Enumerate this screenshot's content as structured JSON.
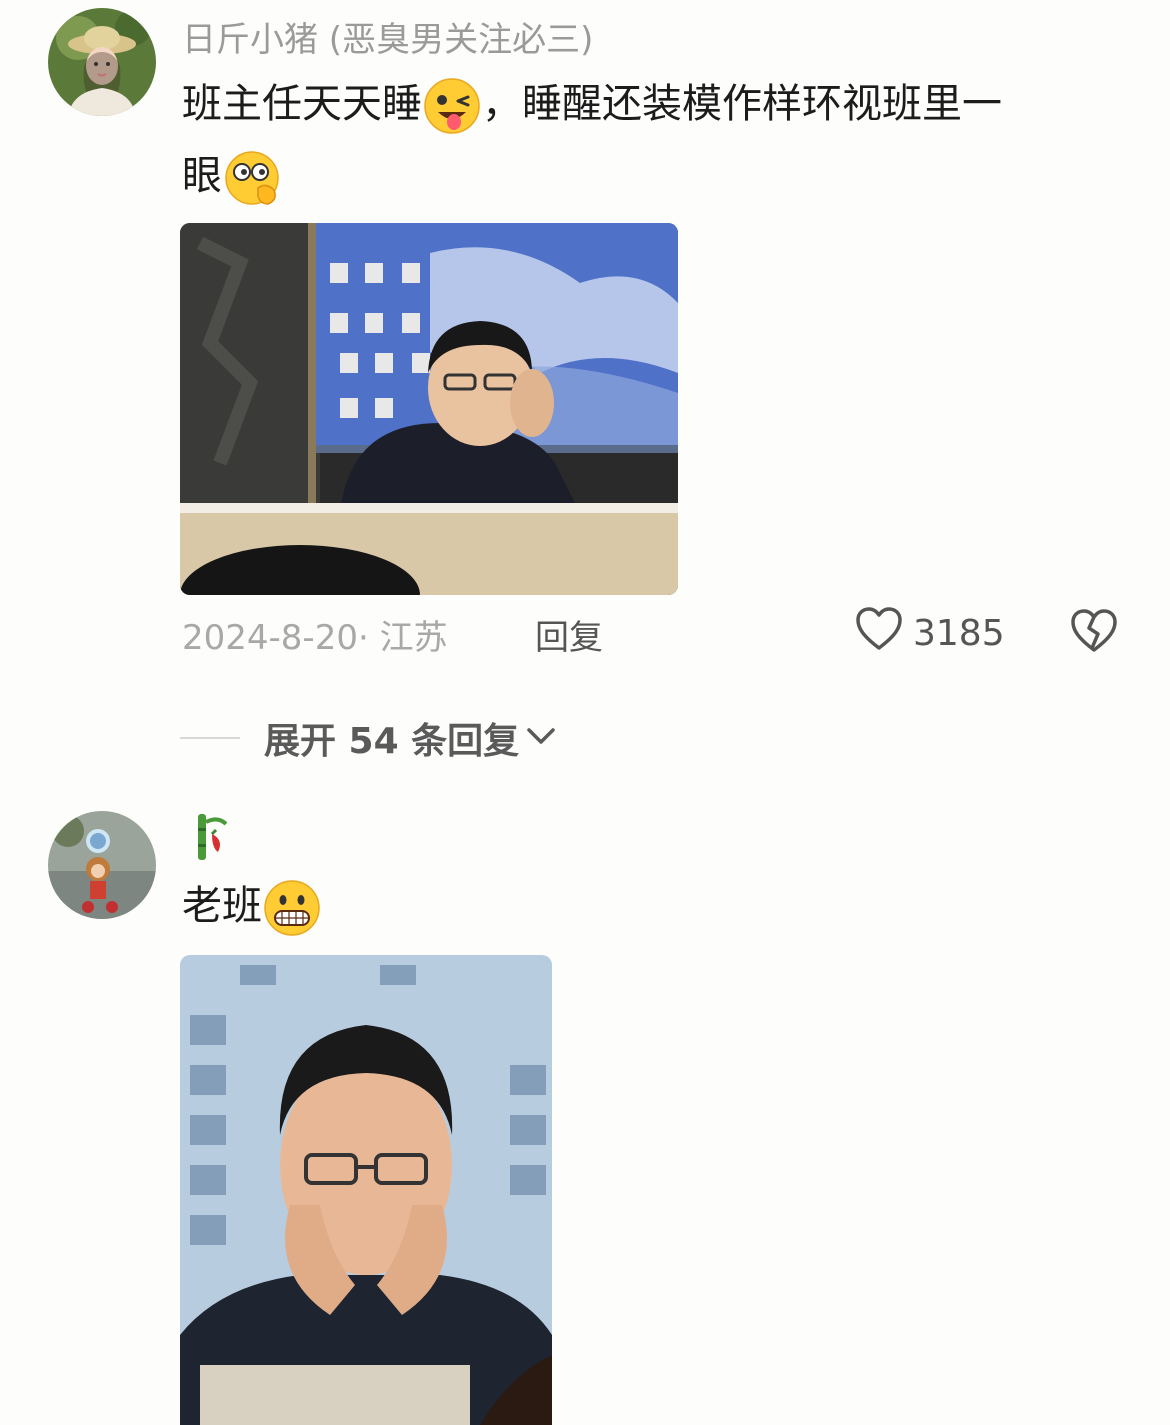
{
  "comments": [
    {
      "username": "日斤小猪 (恶臭男关注必三)",
      "text_part1": "班主任天天睡",
      "text_part2": "，睡醒还装模作样环视班里一",
      "text_part3": "眼",
      "emoji1": "winking-tongue-emoji",
      "emoji2": "thinking-eyes-emoji",
      "date_location": "2024-8-20· 江苏",
      "reply_label": "回复",
      "like_count": "3185",
      "expand_label": "展开 54 条回复"
    },
    {
      "username": "🎋",
      "text": "老班",
      "emoji": "grinning-emoji"
    }
  ],
  "colors": {
    "background": "#fdfdfb",
    "username": "#9a9a9a",
    "text": "#1c1c1c",
    "meta": "#a8a8a8"
  }
}
